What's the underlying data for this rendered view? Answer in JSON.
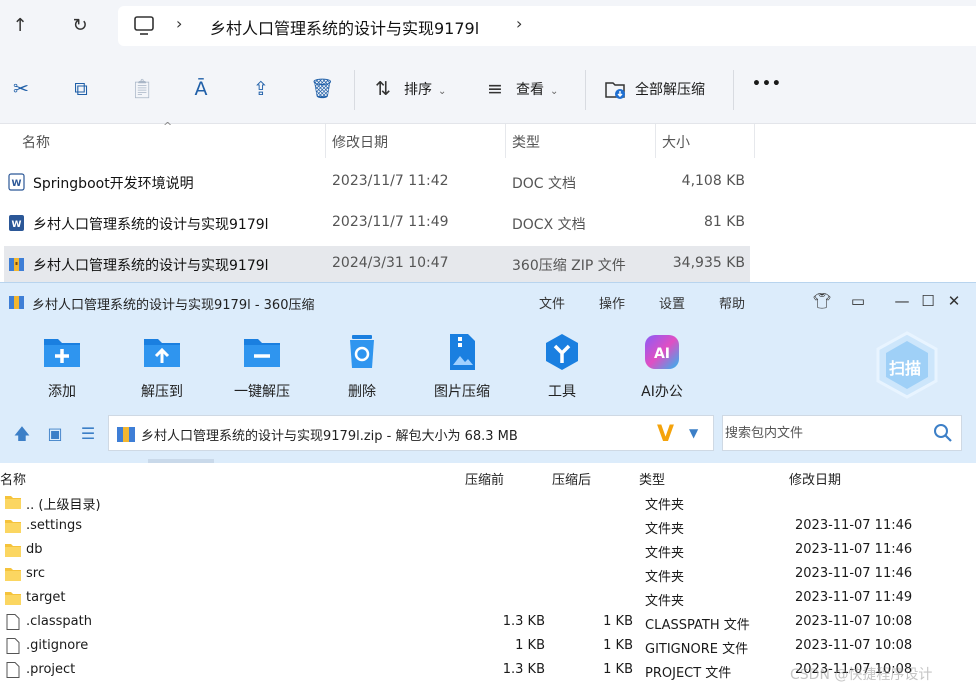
{
  "explorer": {
    "breadcrumb": "乡村人口管理系统的设计与实现9179l",
    "toolbar": {
      "sort_label": "排序",
      "view_label": "查看",
      "extract_all_label": "全部解压缩",
      "more_label": "•••"
    },
    "columns": {
      "name": "名称",
      "date": "修改日期",
      "type": "类型",
      "size": "大小"
    },
    "files": [
      {
        "name": "Springboot开发环境说明",
        "date": "2023/11/7 11:42",
        "type": "DOC 文档",
        "size": "4,108 KB",
        "icon": "word-doc-icon"
      },
      {
        "name": "乡村人口管理系统的设计与实现9179l",
        "date": "2023/11/7 11:49",
        "type": "DOCX 文档",
        "size": "81 KB",
        "icon": "word-docx-icon"
      },
      {
        "name": "乡村人口管理系统的设计与实现9179l",
        "date": "2024/3/31 10:47",
        "type": "360压缩 ZIP 文件",
        "size": "34,935 KB",
        "icon": "zip-icon"
      }
    ]
  },
  "zip360": {
    "title": "乡村人口管理系统的设计与实现9179l - 360压缩",
    "menu": [
      "文件",
      "操作",
      "设置",
      "帮助"
    ],
    "tools": [
      {
        "label": "添加",
        "icon": "add-folder-icon"
      },
      {
        "label": "解压到",
        "icon": "extract-to-icon"
      },
      {
        "label": "一键解压",
        "icon": "one-click-extract-icon"
      },
      {
        "label": "删除",
        "icon": "recycle-bin-icon"
      },
      {
        "label": "图片压缩",
        "icon": "image-compress-icon"
      },
      {
        "label": "工具",
        "icon": "tools-icon"
      },
      {
        "label": "AI办公",
        "icon": "ai-office-icon"
      }
    ],
    "scan_label": "扫描",
    "path_text": "乡村人口管理系统的设计与实现9179l.zip - 解包大小为 68.3 MB",
    "search_placeholder": "搜索包内文件",
    "columns": {
      "name": "名称",
      "packed_before": "压缩前",
      "packed_after": "压缩后",
      "type": "类型",
      "date": "修改日期"
    },
    "rows": [
      {
        "name": ".. (上级目录)",
        "before": "",
        "after": "",
        "type": "文件夹",
        "date": "",
        "kind": "folder"
      },
      {
        "name": ".settings",
        "before": "",
        "after": "",
        "type": "文件夹",
        "date": "2023-11-07 11:46",
        "kind": "folder"
      },
      {
        "name": "db",
        "before": "",
        "after": "",
        "type": "文件夹",
        "date": "2023-11-07 11:46",
        "kind": "folder"
      },
      {
        "name": "src",
        "before": "",
        "after": "",
        "type": "文件夹",
        "date": "2023-11-07 11:46",
        "kind": "folder"
      },
      {
        "name": "target",
        "before": "",
        "after": "",
        "type": "文件夹",
        "date": "2023-11-07 11:49",
        "kind": "folder"
      },
      {
        "name": ".classpath",
        "before": "1.3 KB",
        "after": "1 KB",
        "type": "CLASSPATH 文件",
        "date": "2023-11-07 10:08",
        "kind": "file"
      },
      {
        "name": ".gitignore",
        "before": "1 KB",
        "after": "1 KB",
        "type": "GITIGNORE 文件",
        "date": "2023-11-07 10:08",
        "kind": "file"
      },
      {
        "name": ".project",
        "before": "1.3 KB",
        "after": "1 KB",
        "type": "PROJECT 文件",
        "date": "2023-11-07 10:08",
        "kind": "file"
      }
    ]
  },
  "watermark": "CSDN @快捷程序设计"
}
